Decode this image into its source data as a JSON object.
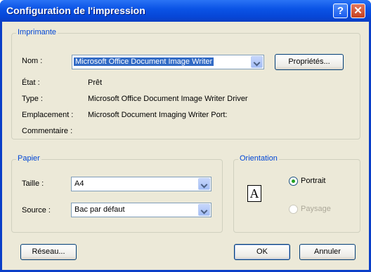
{
  "window": {
    "title": "Configuration de l'impression",
    "help_label": "?",
    "close_label": "✕"
  },
  "printer": {
    "legend": "Imprimante",
    "name_label": "Nom :",
    "name_value": "Microsoft Office Document Image Writer",
    "properties_label": "Propriétés...",
    "status_label": "État :",
    "status_value": "Prêt",
    "type_label": "Type :",
    "type_value": "Microsoft Office Document Image Writer Driver",
    "location_label": "Emplacement :",
    "location_value": "Microsoft Document Imaging Writer Port:",
    "comment_label": "Commentaire :"
  },
  "paper": {
    "legend": "Papier",
    "size_label": "Taille :",
    "size_value": "A4",
    "source_label": "Source :",
    "source_value": "Bac par défaut"
  },
  "orientation": {
    "legend": "Orientation",
    "icon_letter": "A",
    "portrait_label": "Portrait",
    "landscape_label": "Paysage",
    "selected": "Portrait"
  },
  "buttons": {
    "network": "Réseau...",
    "ok": "OK",
    "cancel": "Annuler"
  }
}
